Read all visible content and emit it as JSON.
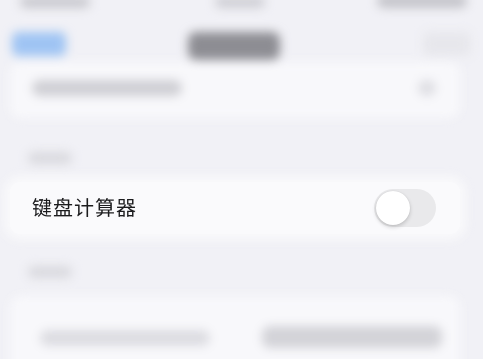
{
  "setting": {
    "label": "键盘计算器",
    "enabled": false
  },
  "colors": {
    "background": "#f1f1f6",
    "card": "#fafafc",
    "toggle_off": "#e9e9eb",
    "toggle_on": "#34c759",
    "accent": "#9fc4f3"
  }
}
